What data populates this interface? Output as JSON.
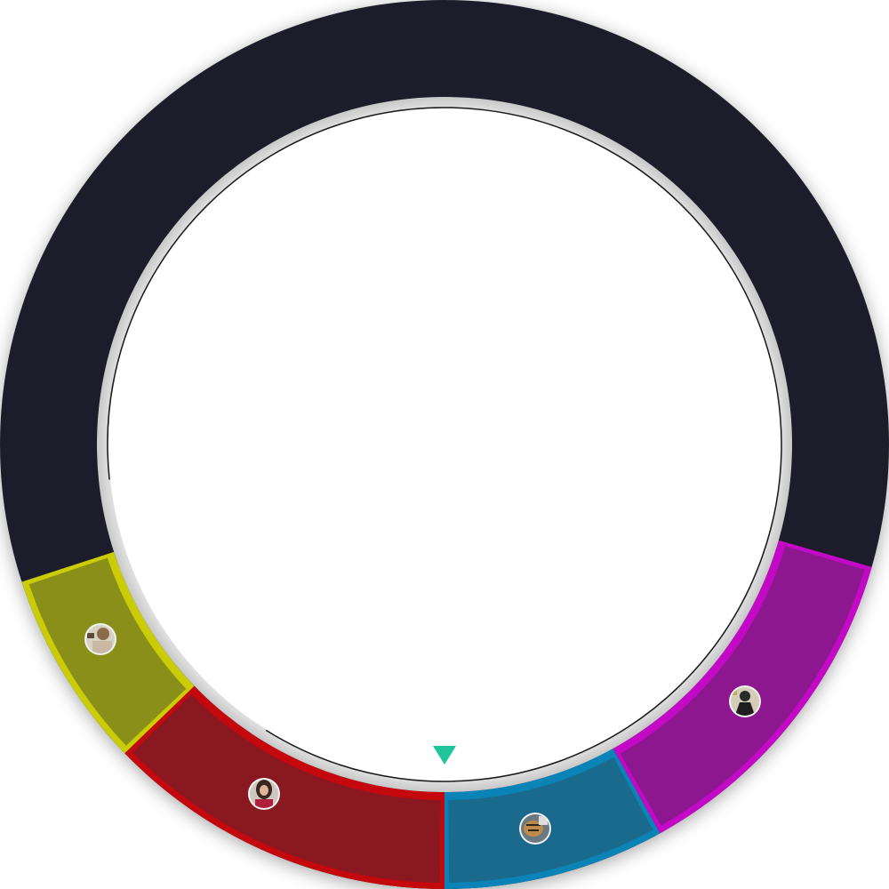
{
  "wheel": {
    "base_color": "#1e1f2a",
    "inner_color": "#ffffff",
    "track_color": "#1a1a1a",
    "pointer": {
      "icon": "triangle-down-icon",
      "color": "#1fc49a"
    },
    "segments": [
      {
        "id": "yellow",
        "fill": "#8a8f1a",
        "edge": "#c9cc06",
        "avatar": "avatar-person-glasses"
      },
      {
        "id": "red",
        "fill": "#8a1820",
        "edge": "#c5080e",
        "avatar": "avatar-woman-dark-hair"
      },
      {
        "id": "blue",
        "fill": "#1a6a8e",
        "edge": "#0a84b6",
        "avatar": "avatar-tiger"
      },
      {
        "id": "magenta",
        "fill": "#8c178f",
        "edge": "#c409c6",
        "avatar": "avatar-dark-figure"
      }
    ]
  }
}
